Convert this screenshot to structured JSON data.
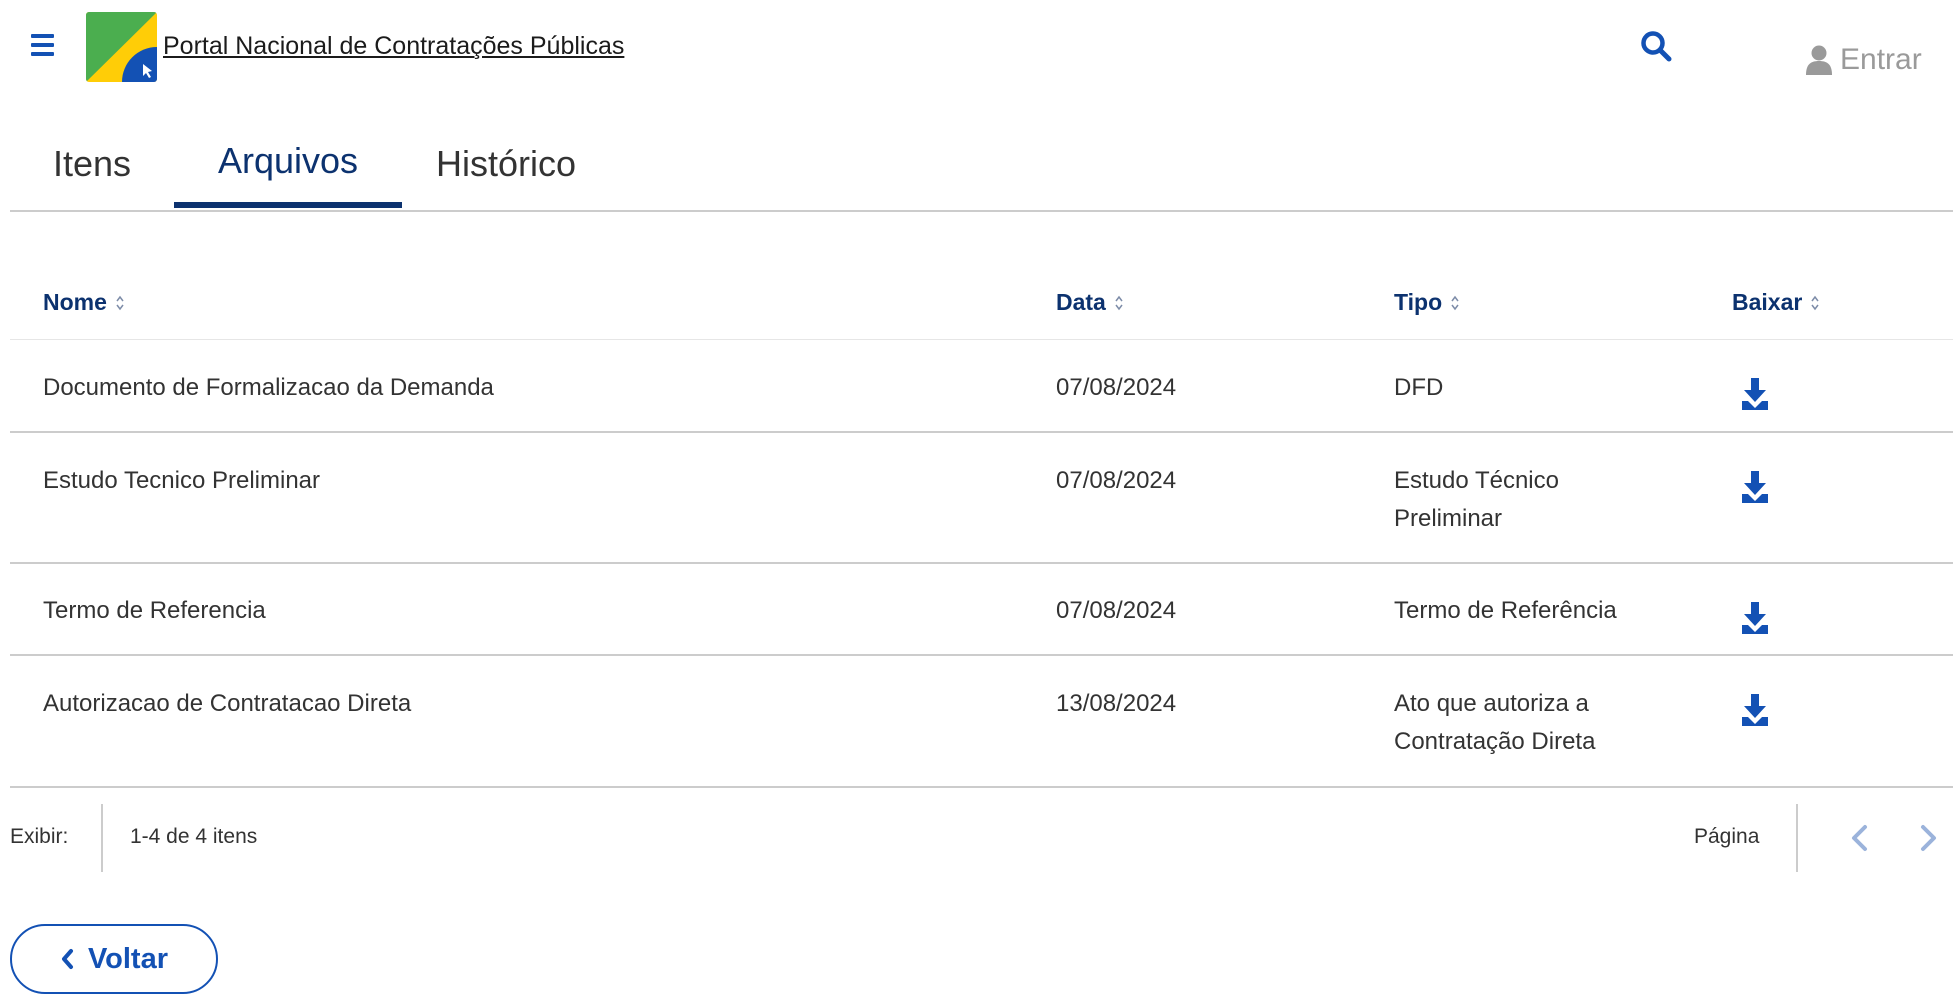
{
  "header": {
    "portal_title": "Portal Nacional de Contratações Públicas",
    "login_label": "Entrar",
    "menu_icon": "hamburger-menu-icon",
    "search_icon": "search-icon",
    "user_icon": "user-icon"
  },
  "tabs": [
    {
      "label": "Itens",
      "active": false
    },
    {
      "label": "Arquivos",
      "active": true
    },
    {
      "label": "Histórico",
      "active": false
    }
  ],
  "table": {
    "columns": [
      "Nome",
      "Data",
      "Tipo",
      "Baixar"
    ],
    "rows": [
      {
        "nome": "Documento de Formalizacao da Demanda",
        "data": "07/08/2024",
        "tipo_lines": [
          "DFD"
        ]
      },
      {
        "nome": "Estudo Tecnico Preliminar",
        "data": "07/08/2024",
        "tipo_lines": [
          "Estudo Técnico",
          "Preliminar"
        ]
      },
      {
        "nome": "Termo de Referencia",
        "data": "07/08/2024",
        "tipo_lines": [
          "Termo de Referência"
        ]
      },
      {
        "nome": "Autorizacao de Contratacao Direta",
        "data": "13/08/2024",
        "tipo_lines": [
          "Ato que autoriza a",
          "Contratação Direta"
        ]
      }
    ]
  },
  "pagination": {
    "show_label": "Exibir:",
    "range_text": "1-4 de 4 itens",
    "page_label": "Página"
  },
  "back_button": {
    "label": "Voltar"
  },
  "colors": {
    "primary": "#1351b4",
    "dark_blue": "#0c326f",
    "muted": "#9a9a9a",
    "divider": "#cccccc"
  }
}
